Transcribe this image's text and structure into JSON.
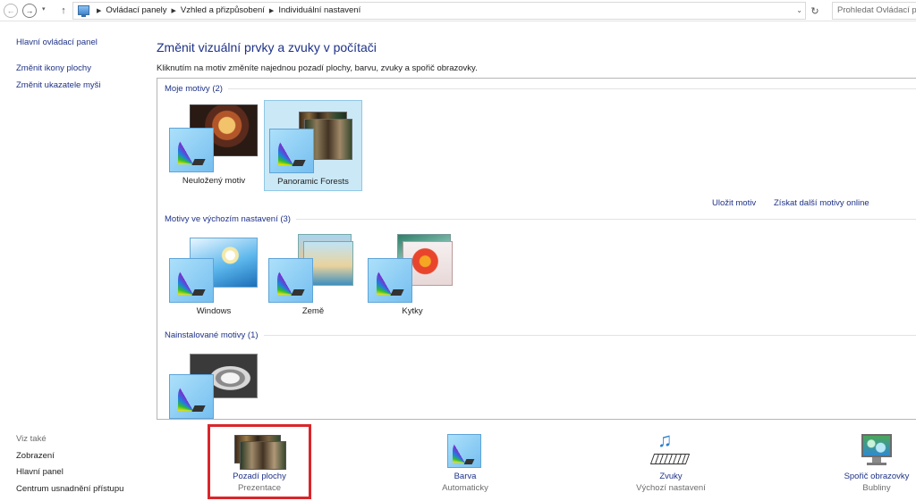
{
  "address_bar": {
    "breadcrumbs": [
      "Ovládací panely",
      "Vzhled a přizpůsobení",
      "Individuální nastavení"
    ],
    "search_placeholder": "Prohledat Ovládací panely"
  },
  "left_pane": {
    "links": [
      "Hlavní ovládací panel",
      "Změnit ikony plochy",
      "Změnit ukazatele myši"
    ],
    "see_also_title": "Viz také",
    "see_also_links": [
      "Zobrazení",
      "Hlavní panel",
      "Centrum usnadnění přístupu"
    ]
  },
  "main": {
    "title": "Změnit vizuální prvky a zvuky v počítači",
    "subtitle": "Kliknutím na motiv změníte najednou pozadí plochy, barvu, zvuky a spořič obrazovky."
  },
  "themes": {
    "my_themes_header": "Moje motivy (2)",
    "my_themes": [
      {
        "label": "Neuložený motiv",
        "selected": false
      },
      {
        "label": "Panoramic Forests",
        "selected": true
      }
    ],
    "save_link": "Uložit motiv",
    "more_online_link": "Získat další motivy online",
    "default_themes_header": "Motivy ve výchozím nastavení (3)",
    "default_themes": [
      {
        "label": "Windows"
      },
      {
        "label": "Země"
      },
      {
        "label": "Kytky"
      }
    ],
    "installed_themes_header": "Nainstalované motivy (1)"
  },
  "bottom_bar": {
    "items": [
      {
        "title": "Pozadí plochy",
        "subtitle": "Prezentace",
        "highlighted": true
      },
      {
        "title": "Barva",
        "subtitle": "Automaticky"
      },
      {
        "title": "Zvuky",
        "subtitle": "Výchozí nastavení"
      },
      {
        "title": "Spořič obrazovky",
        "subtitle": "Bubliny"
      }
    ]
  },
  "colors": {
    "link": "#1e3287",
    "selection_bg": "#cbe8f6",
    "selection_border": "#8fc7e6",
    "highlight_frame": "#d9262c"
  },
  "icons": [
    "back-arrow-icon",
    "forward-arrow-icon",
    "up-arrow-icon",
    "control-panel-icon",
    "refresh-icon",
    "palette-icon",
    "music-notes-icon",
    "screensaver-monitor-icon"
  ]
}
